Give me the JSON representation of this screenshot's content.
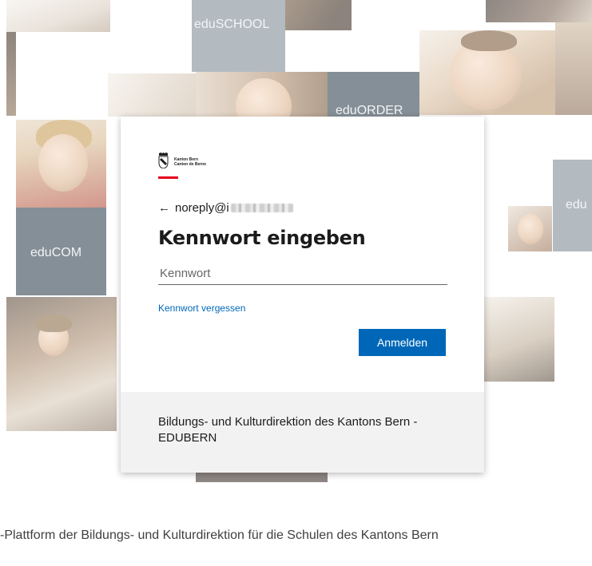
{
  "background": {
    "tiles": {
      "school": "eduSCHOOL",
      "order": "eduORDER",
      "com": "eduCOM",
      "edu_right": "edu"
    },
    "footer": "-Plattform der Bildungs- und Kulturdirektion für die Schulen des Kantons Bern"
  },
  "dialog": {
    "logo": {
      "line1": "Kanton Bern",
      "line2": "Canton de Berne",
      "icon": "bern-coat-of-arms-icon"
    },
    "identity": {
      "back_icon": "←",
      "email_visible": "noreply@i"
    },
    "title": "Kennwort eingeben",
    "password": {
      "placeholder": "Kennwort",
      "value": ""
    },
    "forgot_link": "Kennwort vergessen",
    "signin_button": "Anmelden",
    "org_text": "Bildungs- und Kulturdirektion des Kantons Bern - EDUBERN"
  },
  "colors": {
    "accent": "#0067b8",
    "brand_red": "#e3001b",
    "tile_dark": "#2e3e4c",
    "tile_gray": "#7d8b95",
    "footer_bg": "#f2f2f2"
  }
}
